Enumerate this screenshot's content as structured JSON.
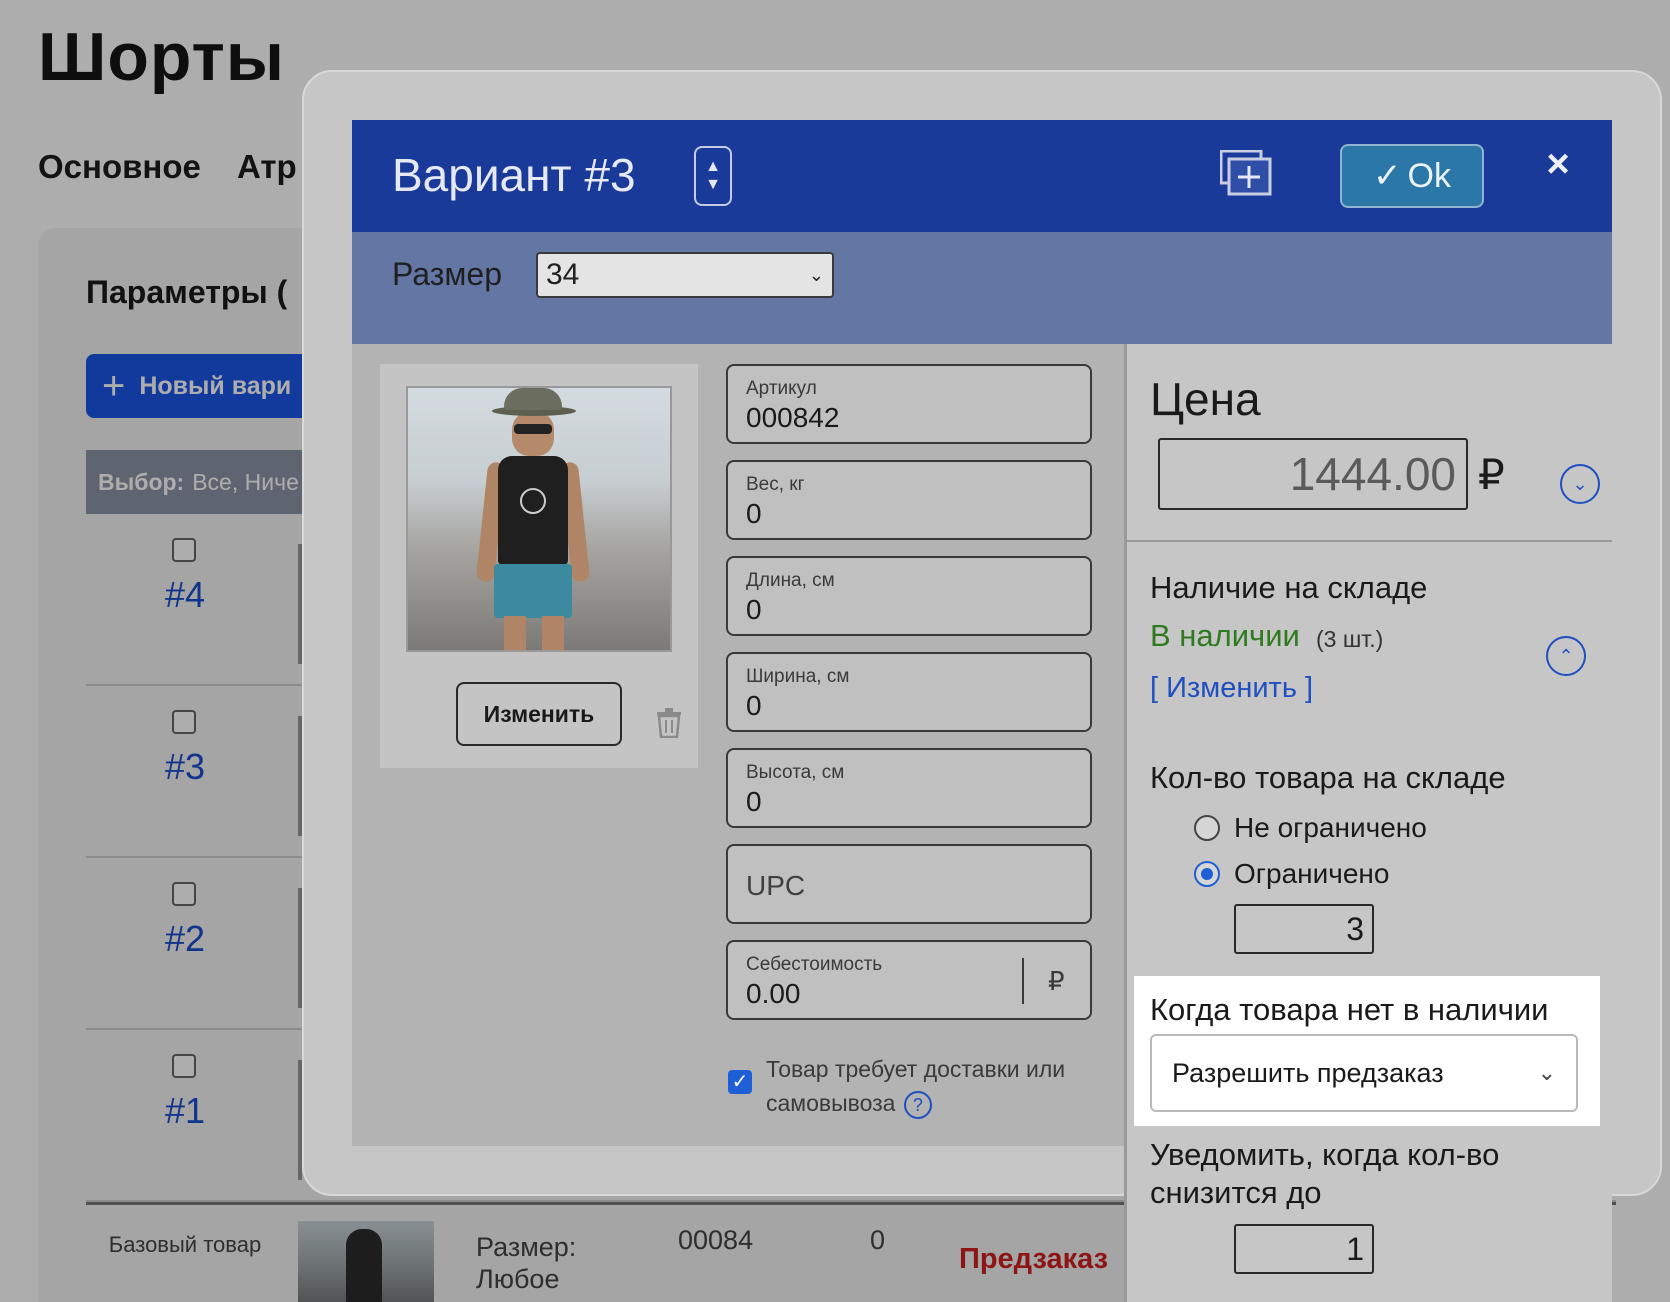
{
  "page": {
    "title": "Шорты",
    "tabs": [
      "Основное",
      "Атр"
    ],
    "panel_title": "Параметры (",
    "new_variant_label": "Новый вари",
    "select_bar": {
      "label": "Выбор:",
      "options": "Все, Ниче"
    },
    "variants": [
      {
        "num": "#4"
      },
      {
        "num": "#3"
      },
      {
        "num": "#2"
      },
      {
        "num": "#1"
      }
    ],
    "base_row": {
      "label": "Базовый товар",
      "size": "Размер: Любое",
      "sku": "00084",
      "weight": "0",
      "status": "Предзаказ"
    }
  },
  "modal": {
    "title": "Вариант #3",
    "ok_label": "Ok",
    "close_label": "×",
    "size_label": "Размер",
    "size_value": "34",
    "change_photo_label": "Изменить",
    "fields": {
      "sku_label": "Артикул",
      "sku_value": "000842",
      "weight_label": "Вес, кг",
      "weight_value": "0",
      "length_label": "Длина, см",
      "length_value": "0",
      "width_label": "Ширина, см",
      "width_value": "0",
      "height_label": "Высота, см",
      "height_value": "0",
      "upc_placeholder": "UPC",
      "cost_label": "Себестоимость",
      "cost_value": "0.00",
      "cost_currency": "₽"
    },
    "shipping_label": "Товар требует доставки или самовывоза",
    "shipping_checked": true,
    "price": {
      "title": "Цена",
      "value": "1444.00",
      "currency": "₽"
    },
    "stock": {
      "title": "Наличие на складе",
      "status": "В наличии",
      "count": "(3 шт.)",
      "change_link": "[ Изменить ]",
      "status_color": "#2f7a1f"
    },
    "quantity": {
      "title": "Кол-во товара на складе",
      "option_unlimited": "Не ограничено",
      "option_limited": "Ограничено",
      "selected": "limited",
      "value": "3"
    },
    "out_of_stock": {
      "title": "Когда товара нет в наличии",
      "selected": "Разрешить предзаказ"
    },
    "notify": {
      "title": "Уведомить, когда кол-во снизится до",
      "value": "1"
    }
  },
  "colors": {
    "header": "#1a3a9a",
    "size_bar": "#6476a4",
    "accent": "#1f5fd6",
    "ok_button": "#2a77a8",
    "preorder": "#d21f1f"
  }
}
